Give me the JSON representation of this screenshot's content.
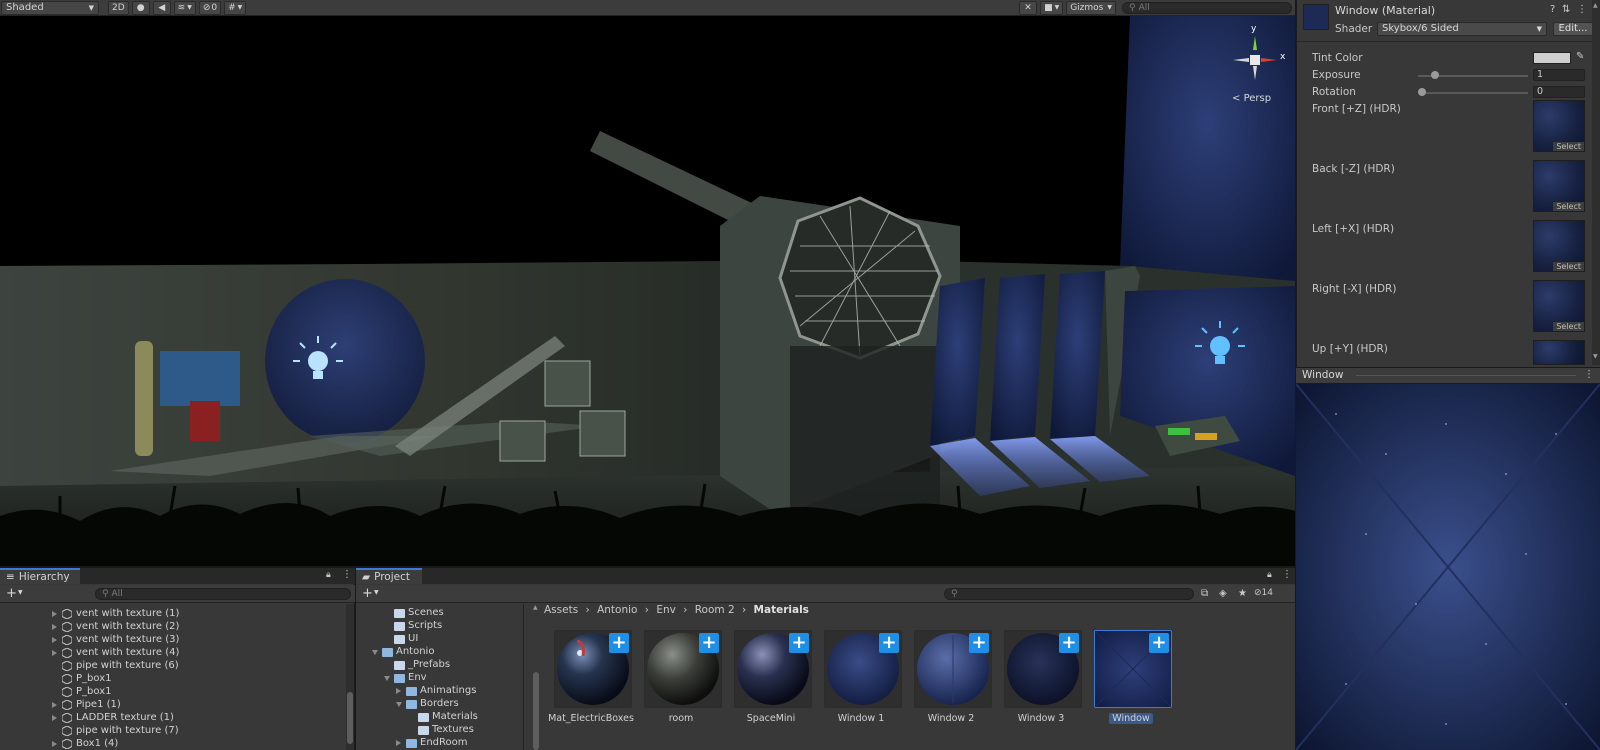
{
  "scene_toolbar": {
    "draw_mode": "Shaded",
    "two_d": "2D",
    "hidden_count": "0",
    "gizmos": "Gizmos",
    "search_placeholder": "All"
  },
  "scene_view": {
    "projection": "Persp",
    "axis_y": "y",
    "axis_x": "x"
  },
  "inspector": {
    "title": "Window (Material)",
    "shader_label": "Shader",
    "shader_value": "Skybox/6 Sided",
    "edit_button": "Edit...",
    "tint_label": "Tint Color",
    "exposure_label": "Exposure",
    "exposure_value": "1",
    "rotation_label": "Rotation",
    "rotation_value": "0",
    "faces": [
      {
        "label": "Front [+Z]   (HDR)",
        "select": "Select"
      },
      {
        "label": "Back [-Z]   (HDR)",
        "select": "Select"
      },
      {
        "label": "Left [+X]   (HDR)",
        "select": "Select"
      },
      {
        "label": "Right [-X]   (HDR)",
        "select": "Select"
      },
      {
        "label": "Up [+Y]   (HDR)"
      }
    ]
  },
  "preview": {
    "title": "Window"
  },
  "hierarchy": {
    "tab": "Hierarchy",
    "search_placeholder": "All",
    "items": [
      "vent with texture (1)",
      "vent with texture (2)",
      "vent with texture (3)",
      "vent with texture (4)",
      "pipe with texture (6)",
      "P_box1",
      "P_box1",
      "Pipe1 (1)",
      "LADDER texture (1)",
      "pipe with texture (7)",
      "Box1 (4)"
    ]
  },
  "project": {
    "tab": "Project",
    "hidden_count": "14",
    "tree": [
      "Scenes",
      "Scripts",
      "UI",
      "Antonio",
      "_Prefabs",
      "Env",
      "Animatings",
      "Borders",
      "Materials",
      "Textures",
      "EndRoom"
    ],
    "breadcrumb": [
      "Assets",
      "Antonio",
      "Env",
      "Room 2",
      "Materials"
    ],
    "assets": [
      "Mat_ElectricBoxes",
      "room",
      "SpaceMini",
      "Window 1",
      "Window 2",
      "Window 3",
      "Window"
    ]
  },
  "colors": {
    "accent": "#3a7bd5",
    "plus_badge": "#1f8fe6",
    "panel_bg": "#383838",
    "toolbar_bg": "#3c3c3c"
  }
}
